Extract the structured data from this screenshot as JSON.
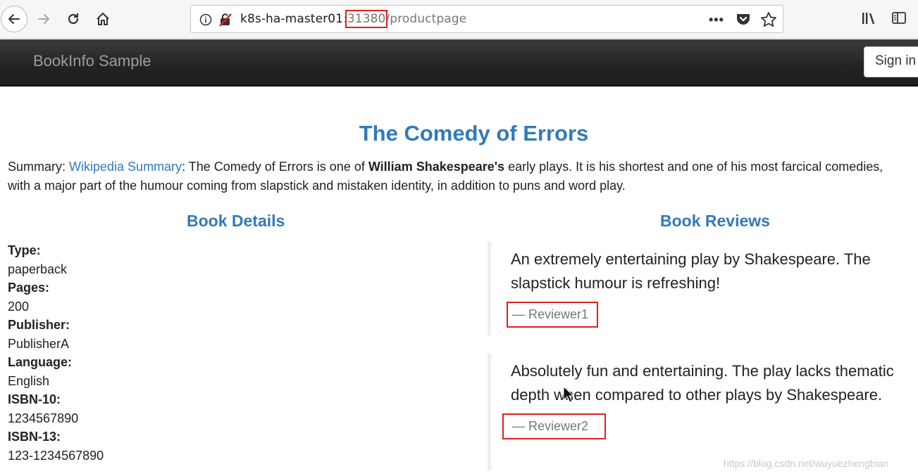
{
  "browser": {
    "url_host": "k8s-ha-master01",
    "url_colon": ":",
    "url_port": "31380",
    "url_path": "/productpage",
    "more_label": "•••"
  },
  "navbar": {
    "brand": "BookInfo Sample",
    "signin_label": "Sign in"
  },
  "product": {
    "title": "The Comedy of Errors",
    "summary_label": "Summary: ",
    "summary_link": "Wikipedia Summary",
    "summary_text_1": ": The Comedy of Errors is one of ",
    "summary_bold": "William Shakespeare's",
    "summary_text_2": " early plays. It is his shortest and one of his most farcical comedies,",
    "summary_line_2": "with a major part of the humour coming from slapstick and mistaken identity, in addition to puns and word play."
  },
  "details": {
    "heading": "Book Details",
    "items": [
      {
        "label": "Type:",
        "value": "paperback"
      },
      {
        "label": "Pages:",
        "value": "200"
      },
      {
        "label": "Publisher:",
        "value": "PublisherA"
      },
      {
        "label": "Language:",
        "value": "English"
      },
      {
        "label": "ISBN-10:",
        "value": "1234567890"
      },
      {
        "label": "ISBN-13:",
        "value": "123-1234567890"
      }
    ]
  },
  "reviews": {
    "heading": "Book Reviews",
    "items": [
      {
        "text": "An extremely entertaining play by Shakespeare. The slapstick humour is refreshing!",
        "reviewer": "— Reviewer1"
      },
      {
        "text": "Absolutely fun and entertaining. The play lacks thematic depth when compared to other plays by Shakespeare.",
        "reviewer": "— Reviewer2"
      }
    ]
  },
  "watermark": "https://blog.csdn.net/wuyuezhengbian",
  "colors": {
    "link": "#337ab7",
    "navbar": "#222222",
    "highlight": "#e02020"
  }
}
